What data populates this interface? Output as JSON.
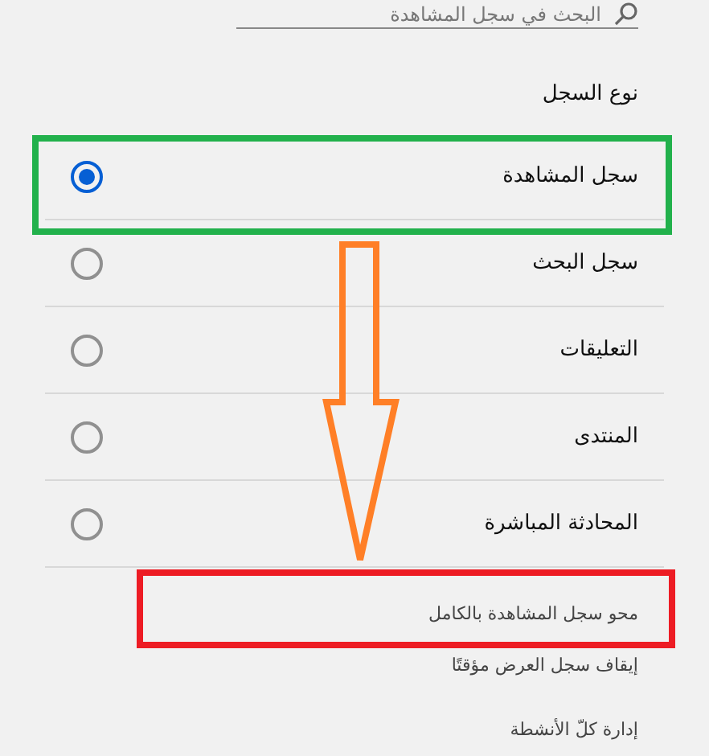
{
  "search": {
    "placeholder": "البحث في سجل المشاهدة"
  },
  "section_title": "نوع السجل",
  "log_types": [
    {
      "label": "سجل المشاهدة",
      "selected": true
    },
    {
      "label": "سجل البحث",
      "selected": false
    },
    {
      "label": "التعليقات",
      "selected": false
    },
    {
      "label": "المنتدى",
      "selected": false
    },
    {
      "label": "المحادثة المباشرة",
      "selected": false
    }
  ],
  "actions": [
    "محو سجل المشاهدة بالكامل",
    "إيقاف سجل العرض مؤقتًا",
    "إدارة كلّ الأنشطة"
  ],
  "annotations": [
    {
      "kind": "box",
      "color": "#22b14c"
    },
    {
      "kind": "arrow",
      "color": "#ff7f27"
    },
    {
      "kind": "box",
      "color": "#ed1c24"
    }
  ]
}
